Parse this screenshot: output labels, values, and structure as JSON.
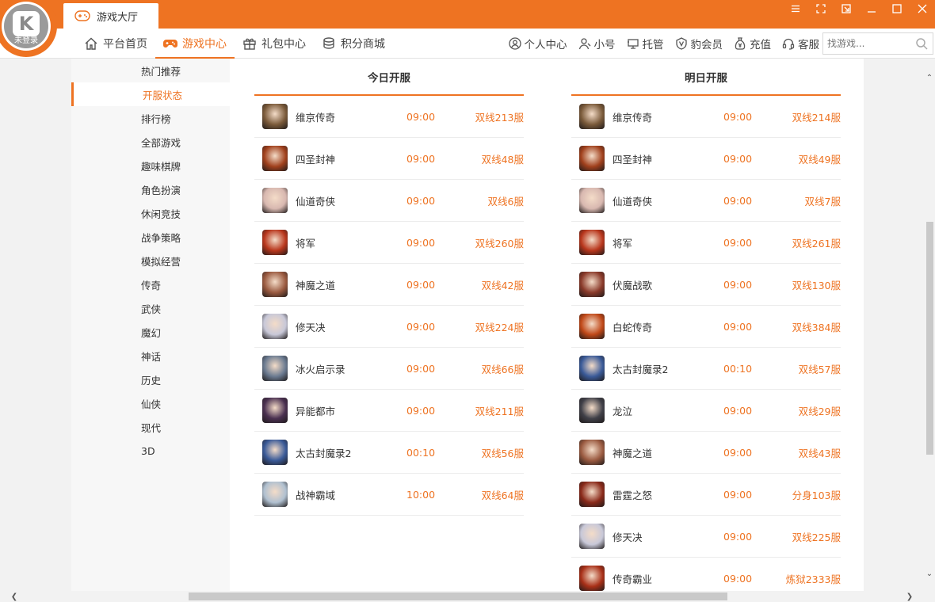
{
  "logo": {
    "status_text": "未登录"
  },
  "titlebar": {
    "tab_label": "游戏大厅"
  },
  "nav": {
    "left": [
      {
        "label": "平台首页",
        "icon": "home-icon"
      },
      {
        "label": "游戏中心",
        "icon": "gamepad-icon",
        "active": true
      },
      {
        "label": "礼包中心",
        "icon": "gift-icon"
      },
      {
        "label": "积分商城",
        "icon": "coins-icon"
      }
    ],
    "right": [
      {
        "label": "个人中心",
        "icon": "user-circle-icon"
      },
      {
        "label": "小号",
        "icon": "users-icon"
      },
      {
        "label": "托管",
        "icon": "monitor-icon"
      },
      {
        "label": "豹会员",
        "icon": "vip-badge-icon"
      },
      {
        "label": "充值",
        "icon": "money-bag-icon"
      },
      {
        "label": "客服",
        "icon": "headset-icon"
      }
    ],
    "search_placeholder": "找游戏..."
  },
  "sidebar": {
    "items": [
      {
        "label": "热门推荐"
      },
      {
        "label": "开服状态",
        "active": true
      },
      {
        "label": "排行榜"
      },
      {
        "label": "全部游戏"
      },
      {
        "label": "趣味棋牌"
      },
      {
        "label": "角色扮演"
      },
      {
        "label": "休闲竞技"
      },
      {
        "label": "战争策略"
      },
      {
        "label": "模拟经营"
      },
      {
        "label": "传奇"
      },
      {
        "label": "武侠"
      },
      {
        "label": "魔幻"
      },
      {
        "label": "神话"
      },
      {
        "label": "历史"
      },
      {
        "label": "仙侠"
      },
      {
        "label": "现代"
      },
      {
        "label": "3D"
      }
    ]
  },
  "today": {
    "title": "今日开服",
    "rows": [
      {
        "name": "维京传奇",
        "time": "09:00",
        "server": "双线213服",
        "color": "#7a5a3a"
      },
      {
        "name": "四圣封神",
        "time": "09:00",
        "server": "双线48服",
        "color": "#a0401c"
      },
      {
        "name": "仙道奇侠",
        "time": "09:00",
        "server": "双线6服",
        "color": "#d8b8b0"
      },
      {
        "name": "将军",
        "time": "09:00",
        "server": "双线260服",
        "color": "#b8361c"
      },
      {
        "name": "神魔之道",
        "time": "09:00",
        "server": "双线42服",
        "color": "#9a5a40"
      },
      {
        "name": "修天决",
        "time": "09:00",
        "server": "双线224服",
        "color": "#c8c8d8"
      },
      {
        "name": "冰火启示录",
        "time": "09:00",
        "server": "双线66服",
        "color": "#6a7a90"
      },
      {
        "name": "异能都市",
        "time": "09:00",
        "server": "双线211服",
        "color": "#4a3050"
      },
      {
        "name": "太古封魔录2",
        "time": "00:10",
        "server": "双线56服",
        "color": "#3a5a98"
      },
      {
        "name": "战神霸域",
        "time": "10:00",
        "server": "双线64服",
        "color": "#b0c0d0"
      }
    ]
  },
  "tomorrow": {
    "title": "明日开服",
    "rows": [
      {
        "name": "维京传奇",
        "time": "09:00",
        "server": "双线214服",
        "color": "#7a5a3a"
      },
      {
        "name": "四圣封神",
        "time": "09:00",
        "server": "双线49服",
        "color": "#a0401c"
      },
      {
        "name": "仙道奇侠",
        "time": "09:00",
        "server": "双线7服",
        "color": "#d8b8b0"
      },
      {
        "name": "将军",
        "time": "09:00",
        "server": "双线261服",
        "color": "#b8361c"
      },
      {
        "name": "伏魔战歌",
        "time": "09:00",
        "server": "双线130服",
        "color": "#8a3a2a"
      },
      {
        "name": "白蛇传奇",
        "time": "09:00",
        "server": "双线384服",
        "color": "#c04818"
      },
      {
        "name": "太古封魔录2",
        "time": "00:10",
        "server": "双线57服",
        "color": "#3a5a98"
      },
      {
        "name": "龙泣",
        "time": "09:00",
        "server": "双线29服",
        "color": "#404048"
      },
      {
        "name": "神魔之道",
        "time": "09:00",
        "server": "双线43服",
        "color": "#9a5a40"
      },
      {
        "name": "雷霆之怒",
        "time": "09:00",
        "server": "分身103服",
        "color": "#8a2a1a"
      },
      {
        "name": "修天决",
        "time": "09:00",
        "server": "双线225服",
        "color": "#c8c8d8"
      },
      {
        "name": "传奇霸业",
        "time": "09:00",
        "server": "炼狱2333服",
        "color": "#a83018"
      }
    ]
  },
  "accent_color": "#ee7322"
}
